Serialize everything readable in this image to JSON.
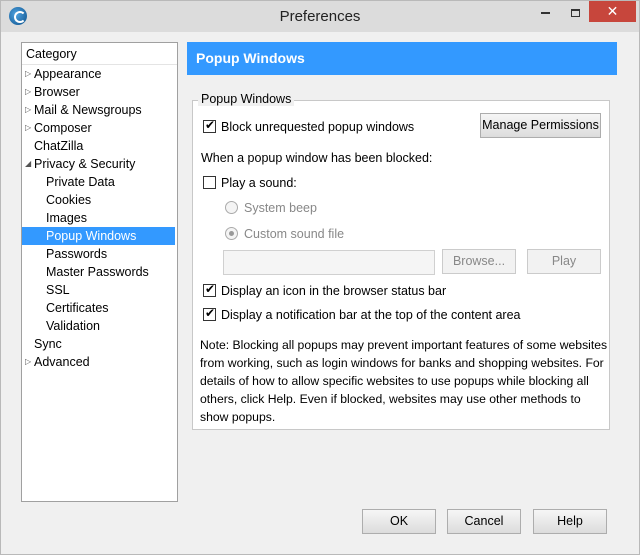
{
  "window": {
    "title": "Preferences"
  },
  "titlebar": {
    "minimize_icon": "minimize-icon",
    "maximize_icon": "maximize-icon",
    "close_glyph": "✕"
  },
  "category": {
    "header": "Category",
    "items": [
      {
        "label": "Appearance",
        "expandable": true
      },
      {
        "label": "Browser",
        "expandable": true
      },
      {
        "label": "Mail & Newsgroups",
        "expandable": true
      },
      {
        "label": "Composer",
        "expandable": true
      },
      {
        "label": "ChatZilla",
        "expandable": false
      },
      {
        "label": "Privacy & Security",
        "expanded": true
      },
      {
        "label": "Private Data",
        "child": true
      },
      {
        "label": "Cookies",
        "child": true
      },
      {
        "label": "Images",
        "child": true
      },
      {
        "label": "Popup Windows",
        "child": true,
        "selected": true
      },
      {
        "label": "Passwords",
        "child": true
      },
      {
        "label": "Master Passwords",
        "child": true
      },
      {
        "label": "SSL",
        "child": true
      },
      {
        "label": "Certificates",
        "child": true
      },
      {
        "label": "Validation",
        "child": true
      },
      {
        "label": "Sync",
        "expandable": false
      },
      {
        "label": "Advanced",
        "expandable": true
      }
    ]
  },
  "panel": {
    "title": "Popup Windows",
    "group_label": "Popup Windows",
    "block_popups_label": "Block unrequested popup windows",
    "block_popups_checked": true,
    "manage_permissions_label": "Manage Permissions",
    "when_blocked_label": "When a popup window has been blocked:",
    "play_sound_label": "Play a sound:",
    "play_sound_checked": false,
    "system_beep_label": "System beep",
    "custom_sound_label": "Custom sound file",
    "sound_file_value": "",
    "browse_label": "Browse...",
    "play_label": "Play",
    "status_icon_label": "Display an icon in the browser status bar",
    "status_icon_checked": true,
    "notification_bar_label": "Display a notification bar at the top of the content area",
    "notification_bar_checked": true,
    "note": "Note: Blocking all popups may prevent important features of some websites from working, such as login windows for banks and shopping websites. For details of how to allow specific websites to use popups while blocking all others, click Help. Even if blocked, websites may use other methods to show popups."
  },
  "footer": {
    "ok_label": "OK",
    "cancel_label": "Cancel",
    "help_label": "Help"
  },
  "colors": {
    "accent": "#3399ff"
  }
}
